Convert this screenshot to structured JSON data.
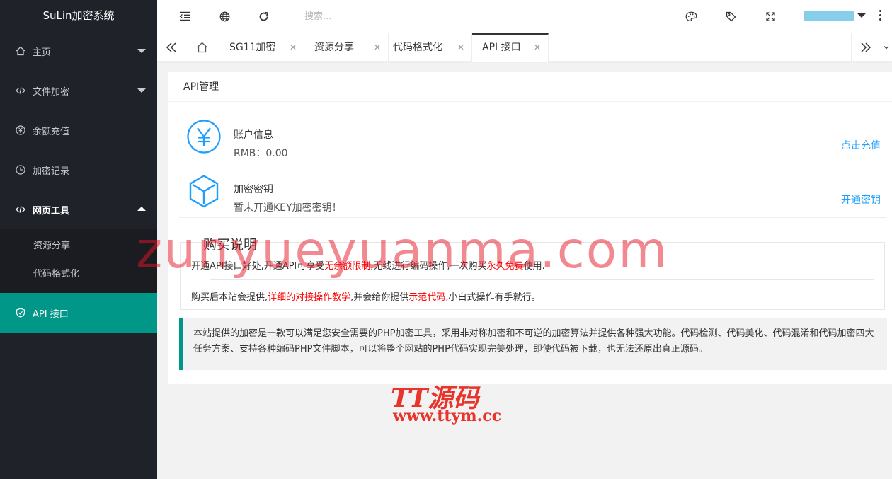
{
  "app": {
    "title": "SuLin加密系统"
  },
  "sidebar": {
    "items": [
      {
        "label": "主页",
        "icon": "home-icon"
      },
      {
        "label": "文件加密",
        "icon": "code-icon"
      },
      {
        "label": "余额充值",
        "icon": "yen-icon"
      },
      {
        "label": "加密记录",
        "icon": "clock-icon"
      },
      {
        "label": "网页工具",
        "icon": "code-icon"
      }
    ],
    "sub_items": [
      {
        "label": "资源分享"
      },
      {
        "label": "代码格式化"
      }
    ],
    "active_item": {
      "label": "API 接口",
      "icon": "shield-icon"
    }
  },
  "header": {
    "search_placeholder": "搜索..."
  },
  "tabs": [
    {
      "label": "SG11加密"
    },
    {
      "label": "资源分享"
    },
    {
      "label": "代码格式化"
    },
    {
      "label": "API 接口"
    }
  ],
  "main": {
    "title": "API管理",
    "account": {
      "title": "账户信息",
      "value": "RMB：0.00",
      "action": "点击充值"
    },
    "key": {
      "title": "加密密钥",
      "value": "暂未开通KEY加密密钥！",
      "action": "开通密钥"
    },
    "purchase": {
      "legend": "购买说明",
      "line1_a": "开通API接口好处,开通API可享受",
      "line1_b": "无余额限制",
      "line1_c": ",无线进行编码操作,一次购买",
      "line1_d": "永久免费",
      "line1_e": "使用.",
      "line2_a": "购买后本站会提供,",
      "line2_b": "详细的对接操作教学",
      "line2_c": ",并会给你提供",
      "line2_d": "示范代码",
      "line2_e": ",小白式操作有手就行。"
    },
    "note": "本站提供的加密是一款可以满足您安全需要的PHP加密工具，采用非对称加密和不可逆的加密算法并提供各种强大功能。代码检测、代码美化、代码混淆和代码加密四大任务方案、支持各种编码PHP文件脚本，可以将整个网站的PHP代码实现完美处理，即使代码被下载，也无法还原出真正源码。"
  },
  "watermark": {
    "domain": "zunyueyuanma.com",
    "logo": "TT源码",
    "url": "www.ttym.cc"
  },
  "colors": {
    "sidebar_bg": "#20222a",
    "active_green": "#009688",
    "link_blue": "#1e9fff",
    "highlight_red": "#ff0000"
  }
}
